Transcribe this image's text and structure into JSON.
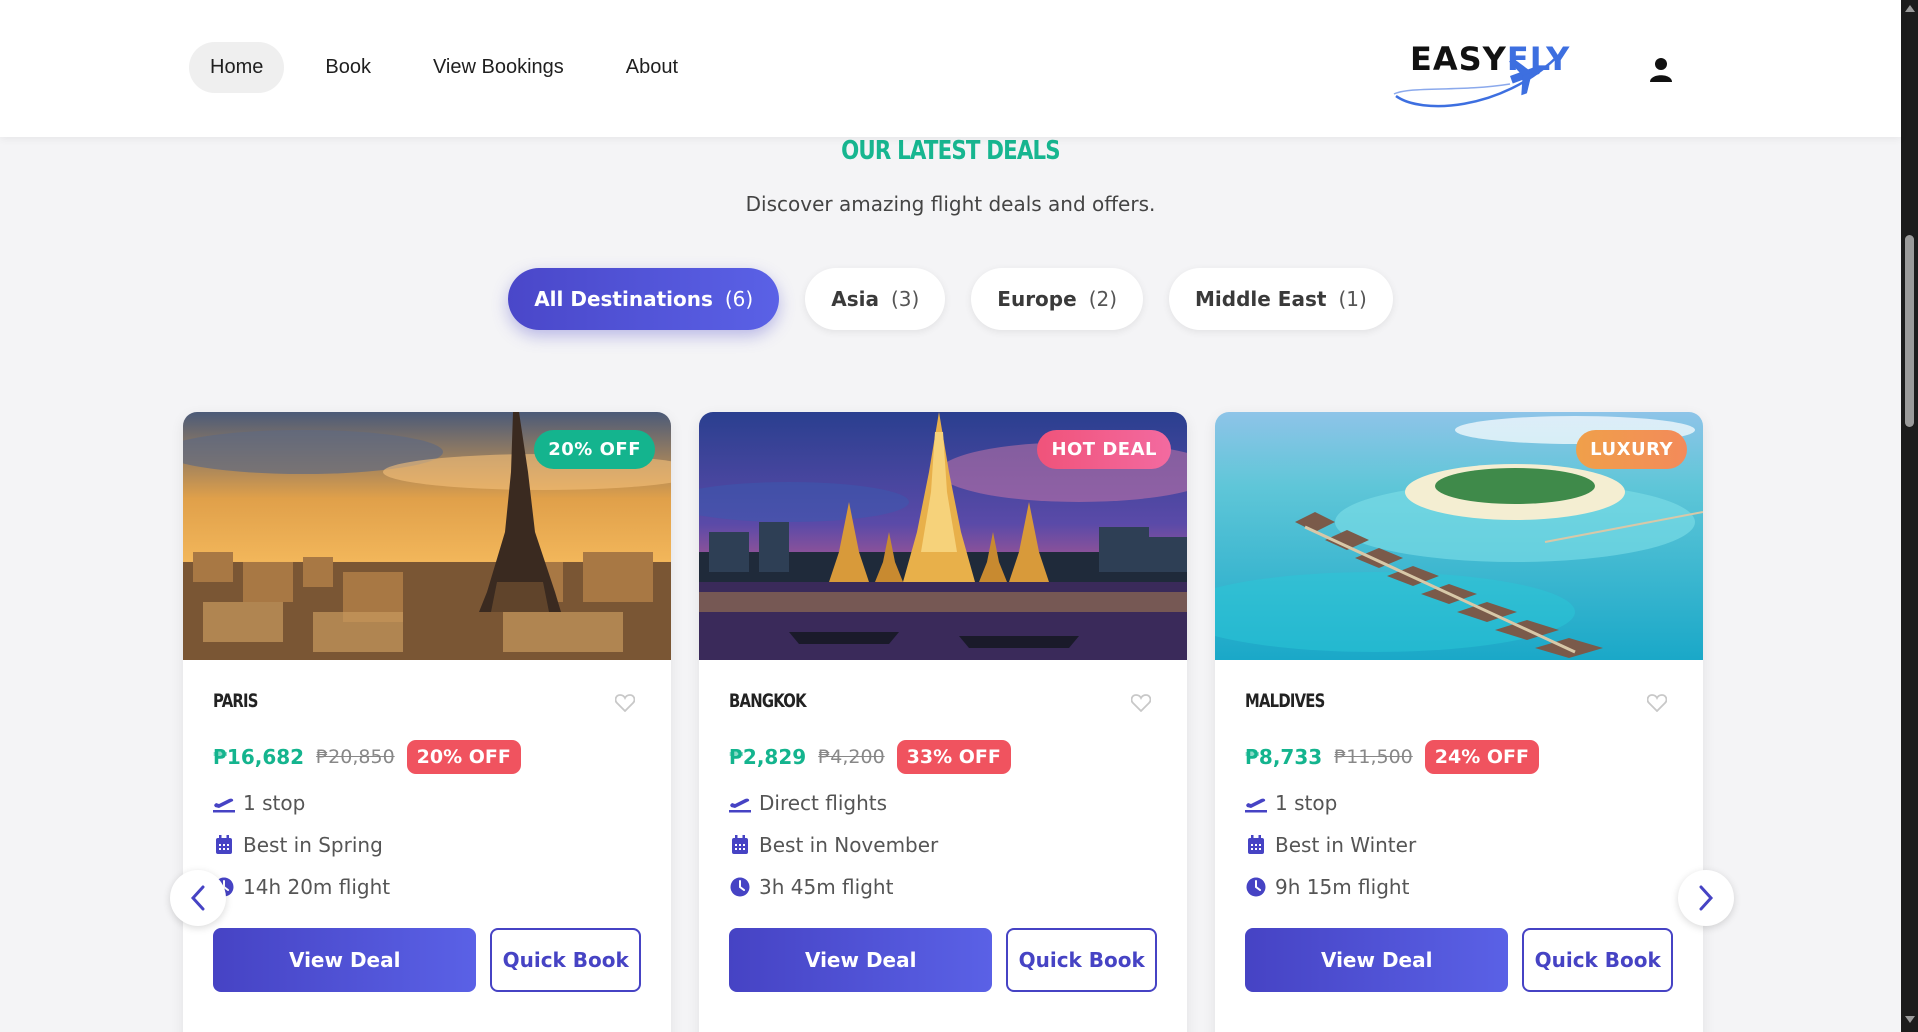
{
  "nav": {
    "items": [
      {
        "label": "Home",
        "active": true
      },
      {
        "label": "Book",
        "active": false
      },
      {
        "label": "View Bookings",
        "active": false
      },
      {
        "label": "About",
        "active": false
      }
    ],
    "logo": {
      "part1": "EASY",
      "part2": "FLY"
    }
  },
  "section": {
    "title": "OUR LATEST DEALS",
    "subtitle": "Discover amazing flight deals and offers."
  },
  "filters": [
    {
      "label": "All Destinations",
      "count": "(6)",
      "active": true
    },
    {
      "label": "Asia",
      "count": "(3)",
      "active": false
    },
    {
      "label": "Europe",
      "count": "(2)",
      "active": false
    },
    {
      "label": "Middle East",
      "count": "(1)",
      "active": false
    }
  ],
  "cards": [
    {
      "name": "PARIS",
      "badge": "20% OFF",
      "badge_color": "#14b48e",
      "price": "₱16,682",
      "old_price": "₱20,850",
      "discount": "20% OFF",
      "stops": "1 stop",
      "season": "Best in Spring",
      "duration": "14h 20m flight",
      "view_label": "View Deal",
      "quick_label": "Quick Book"
    },
    {
      "name": "BANGKOK",
      "badge": "HOT DEAL",
      "badge_color": "#f0537a",
      "price": "₱2,829",
      "old_price": "₱4,200",
      "discount": "33% OFF",
      "stops": "Direct flights",
      "season": "Best in November",
      "duration": "3h 45m flight",
      "view_label": "View Deal",
      "quick_label": "Quick Book"
    },
    {
      "name": "MALDIVES",
      "badge": "LUXURY",
      "badge_color": "#f59a4a",
      "price": "₱8,733",
      "old_price": "₱11,500",
      "discount": "24% OFF",
      "stops": "1 stop",
      "season": "Best in Winter",
      "duration": "9h 15m flight",
      "view_label": "View Deal",
      "quick_label": "Quick Book"
    }
  ],
  "colors": {
    "accent": "#4a47c9",
    "price_green": "#14b48e",
    "discount_red": "#f0535f"
  }
}
